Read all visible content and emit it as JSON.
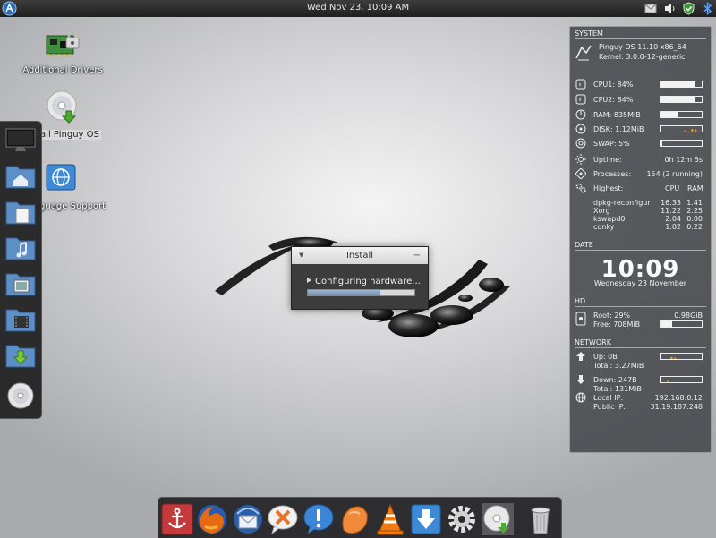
{
  "top_panel": {
    "clock": "Wed Nov 23, 10:09 AM"
  },
  "desktop": {
    "icons": [
      {
        "label": "Additional Drivers",
        "icon": "drivers-icon"
      },
      {
        "label": "Install Pinguy OS",
        "icon": "install-cd-icon"
      },
      {
        "label": "Language Support",
        "icon": "language-support-icon"
      }
    ],
    "install_icon_visible_label": "tall Pinguy OS",
    "language_icon_visible_label": "Language Support"
  },
  "left_dock": {
    "items": [
      "monitor-icon",
      "home-folder-icon",
      "documents-folder-icon",
      "music-folder-icon",
      "pictures-folder-icon",
      "videos-folder-icon",
      "downloads-folder-icon",
      "cd-drive-icon"
    ]
  },
  "bottom_dock": {
    "items": [
      "anchor-icon",
      "firefox-icon",
      "thunderbird-icon",
      "crossed-chat-icon",
      "info-chat-icon",
      "orange-blob-icon",
      "vlc-icon",
      "download-icon",
      "settings-gear-icon",
      "install-cd-icon",
      "trash-icon"
    ]
  },
  "install_dialog": {
    "title": "Install",
    "status": "Configuring hardware...",
    "progress": 0.68
  },
  "conky": {
    "system_header": "SYSTEM",
    "os": "Pinguy OS 11.10 x86_64",
    "kernel": "Kernel: 3.0.0-12-generic",
    "cpu1": "CPU1: 84%",
    "cpu1_value": 0.84,
    "cpu2": "CPU2: 84%",
    "cpu2_value": 0.84,
    "ram": "RAM: 835MiB",
    "ram_value": 0.42,
    "disk": "DISK: 1.12MiB",
    "swap": "SWAP: 5%",
    "swap_value": 0.05,
    "uptime_label": "Uptime:",
    "uptime_value": "0h 12m 5s",
    "processes_label": "Processes:",
    "processes_value": "154 (2 running)",
    "highest_label": "Highest:",
    "col_cpu": "CPU",
    "col_ram": "RAM",
    "procs": [
      {
        "name": "dpkg-reconfigur",
        "cpu": "16.33",
        "ram": "1.41"
      },
      {
        "name": "Xorg",
        "cpu": "11.22",
        "ram": "2.25"
      },
      {
        "name": "kswapd0",
        "cpu": "2.04",
        "ram": "0.00"
      },
      {
        "name": "conky",
        "cpu": "1.02",
        "ram": "0.22"
      }
    ],
    "date_header": "DATE",
    "time": "10:09",
    "date": "Wednesday 23 November",
    "hd_header": "HD",
    "root": "Root: 29%",
    "root_size": "0.98GiB",
    "free": "Free: 708MiB",
    "root_value": 0.29,
    "network_header": "NETWORK",
    "up": "Up: 0B",
    "up_total": "Total: 3.27MiB",
    "down": "Down: 247B",
    "down_total": "Total: 131MiB",
    "local_ip_label": "Local IP:",
    "local_ip": "192.168.0.12",
    "public_ip_label": "Public IP:",
    "public_ip": "31.19.187.248"
  }
}
